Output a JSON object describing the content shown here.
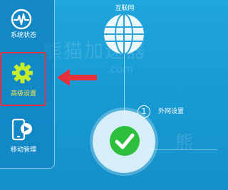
{
  "sidebar": {
    "items": [
      {
        "label": "系统状态",
        "icon": "pulse-icon"
      },
      {
        "label": "高级设置",
        "icon": "gear-icon"
      },
      {
        "label": "移动管理",
        "icon": "mobile-icon"
      }
    ]
  },
  "main": {
    "internet_label": "互联网",
    "step_number": "1",
    "step_label": "外网设置"
  },
  "colors": {
    "background": "#1a9ed6",
    "highlight": "#e8303a",
    "accent_yellow": "#ffe44d",
    "check_green": "#2bbf3c"
  }
}
